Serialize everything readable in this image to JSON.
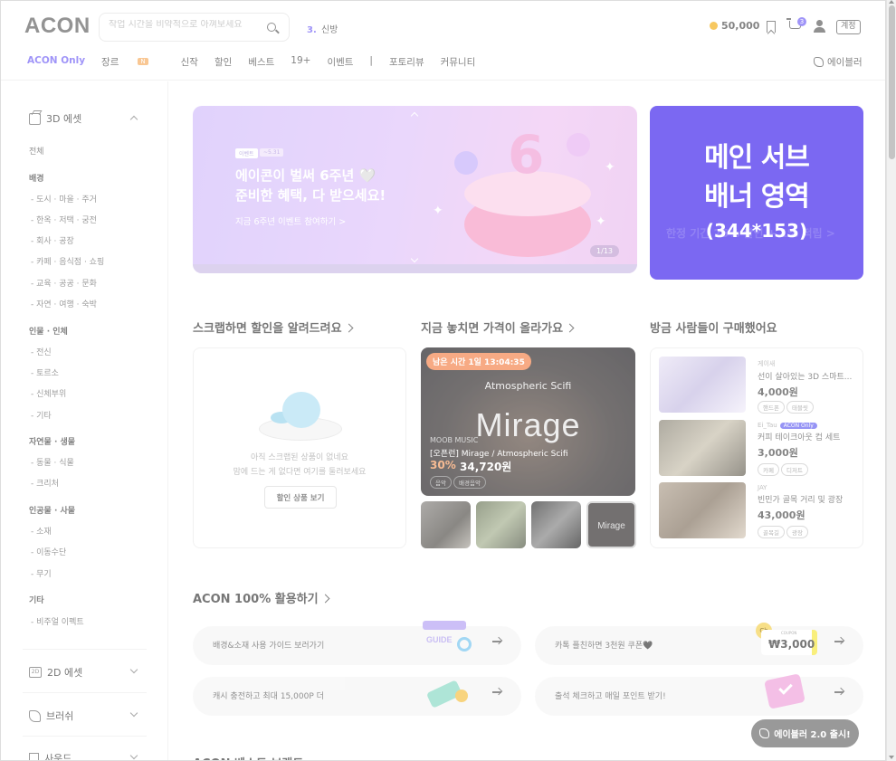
{
  "header": {
    "logo": "ACON",
    "search_placeholder": "작업 시간을 비약적으로 아껴보세요",
    "trending_rank": "3.",
    "trending_text": "신방",
    "points": "50,000",
    "cart_count": "3",
    "lang_label": "계정"
  },
  "nav": {
    "items": [
      "ACON Only",
      "장르",
      "신작",
      "할인",
      "베스트",
      "19+",
      "이벤트",
      "|",
      "포토리뷰",
      "커뮤니티"
    ],
    "new_badge": "N",
    "editor_label": "에이블러"
  },
  "sidebar": {
    "asset3d_label": "3D 에셋",
    "all_label": "전체",
    "groups": [
      {
        "title": "배경",
        "items": [
          "도시 · 마을 · 주거",
          "한옥 · 저택 · 궁전",
          "회사 · 공장",
          "카페 · 음식점 · 쇼핑",
          "교육 · 공공 · 문화",
          "자연 · 여행 · 숙박"
        ]
      },
      {
        "title": "인물 · 인체",
        "items": [
          "전신",
          "토르소",
          "신체부위",
          "기타"
        ]
      },
      {
        "title": "자연물 · 생물",
        "items": [
          "동물 · 식물",
          "크리처"
        ]
      },
      {
        "title": "인공물 · 사물",
        "items": [
          "소재",
          "이동수단",
          "무기"
        ]
      },
      {
        "title": "기타",
        "items": [
          "비주얼 이펙트"
        ]
      }
    ],
    "asset2d_label": "2D 에셋",
    "brush_label": "브러쉬",
    "sound_label": "사운드"
  },
  "banner": {
    "tag1": "이벤트",
    "tag2": "~5.31",
    "headline_line1": "에이콘이 벌써 6주년 🤍",
    "headline_line2": "준비한 혜택, 다 받으세요!",
    "cta": "지금 6주년 이벤트 참여하기 >",
    "pager": "1/13",
    "cake_number": "6"
  },
  "subbanner": {
    "line1": "메인 서브",
    "line2": "배너 영역",
    "dims": "(344*153)",
    "ghost_text": "한정 기간 25% 할인 + 1% 적립 >"
  },
  "sections": {
    "scrap_title": "스크랩하면 할인을 알려드려요",
    "deal_title": "지금 놓치면 가격이 올라가요",
    "recent_title": "방금 사람들이 구매했어요",
    "utilize_title": "ACON 100% 활용하기",
    "brand_title": "ACON 베스트 브랜드"
  },
  "scrap": {
    "empty_line1": "아직 스크랩된 상품이 없네요",
    "empty_line2": "맘에 드는 게 없다면 여기를 둘러보세요",
    "button": "할인 상품 보기"
  },
  "deal": {
    "timer": "남은 시간 1일 13:04:35",
    "subtitle": "Atmospheric Scifi",
    "big_title": "Mirage",
    "brand": "MOOB MUSIC",
    "product": "[오픈런] Mirage / Atmospheric Scifi",
    "discount": "30%",
    "price": "34,720원",
    "chips": [
      "음악",
      "배경음악"
    ],
    "thumb_label": "Mirage"
  },
  "recent": [
    {
      "seller": "게이새",
      "name": "선이 살아있는 3D 스마트...",
      "price": "4,000원",
      "chips": [
        "핸드폰",
        "태블릿"
      ]
    },
    {
      "seller": "Ei_Tau",
      "badge": "ACON Only",
      "name": "커피 테이크아웃 컵 세트",
      "price": "3,000원",
      "chips": [
        "카페",
        "디저트"
      ]
    },
    {
      "seller": "JAY",
      "name": "빈민가 골목 거리 및 광장",
      "price": "43,000원",
      "chips": [
        "골목길",
        "광장"
      ]
    }
  ],
  "utilities": [
    {
      "text": "배경&소재 사용 가이드 보러가기",
      "icon_label": "GUIDE"
    },
    {
      "text": "카톡 플친하면 3천원 쿠폰🖤",
      "icon_label": "₩3,000",
      "coupon_label": "COUPON",
      "coin_label": "Ch"
    },
    {
      "text": "캐시 충전하고 최대 15,000P 더"
    },
    {
      "text": "출석 체크하고 매일 포인트 받기!"
    }
  ],
  "floating": {
    "label": "에이블러 2.0 출시!"
  },
  "colors": {
    "brand_purple": "#7b6cf6",
    "subbanner_bg": "#7b68f2",
    "discount_orange": "#f5a26a",
    "timer_orange": "#f48a55"
  }
}
